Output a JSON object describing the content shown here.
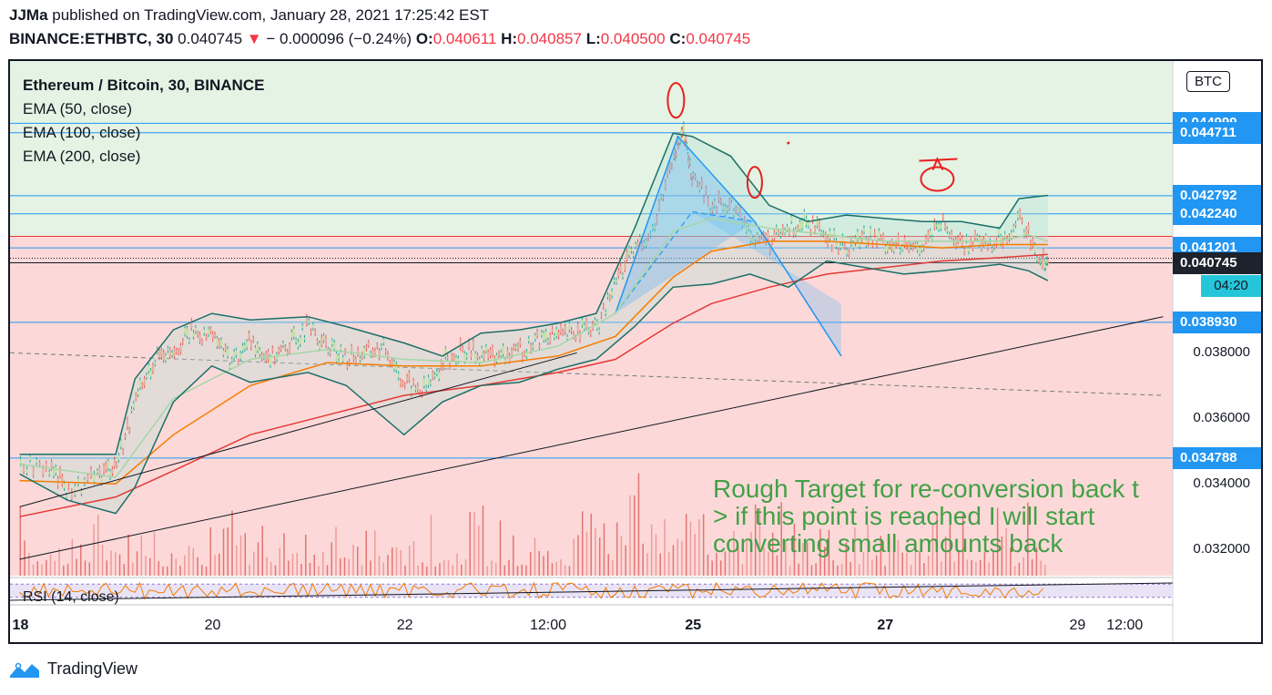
{
  "header": {
    "author": "JJMa",
    "published_text": " published on TradingView.com, January 28, 2021 17:25:42 EST",
    "symbol": "BINANCE:ETHBTC, 30",
    "last": "0.040745",
    "change": "− 0.000096 (−0.24%)",
    "o_label": "O:",
    "o_value": "0.040611",
    "h_label": "H:",
    "h_value": "0.040857",
    "l_label": "L:",
    "l_value": "0.040500",
    "c_label": "C:",
    "c_value": "0.040745"
  },
  "legend": {
    "title": "Ethereum / Bitcoin, 30, BINANCE",
    "ema50": "EMA (50, close)",
    "ema100": "EMA (100, close)",
    "ema200": "EMA (200, close)"
  },
  "currency_badge": "BTC",
  "rsi_label": "RSI (14, close)",
  "annotation": [
    "Rough Target for re-conversion back t",
    "> if this point is reached I will start",
    "converting small amounts back"
  ],
  "footer": {
    "brand": "TradingView"
  },
  "colors": {
    "green_zone": "#e4f3e3",
    "red_zone": "#fcd9d8",
    "ema50": "#a5d6a7",
    "ema100": "#f57c00",
    "ema200": "#e53935",
    "bb": "#1b6f67",
    "hline": "#2196f3",
    "annotation": "#43a047",
    "marker": "#e91e1e"
  },
  "chart_data": {
    "type": "candlestick",
    "x_ticks": [
      {
        "label": "18",
        "t": 0,
        "bold": true
      },
      {
        "label": "20",
        "t": 2
      },
      {
        "label": "22",
        "t": 4
      },
      {
        "label": "12:00",
        "t": 5.5
      },
      {
        "label": "25",
        "t": 7,
        "bold": true
      },
      {
        "label": "27",
        "t": 9,
        "bold": true
      },
      {
        "label": "29",
        "t": 11
      },
      {
        "label": "12:00",
        "t": 11.5
      }
    ],
    "xlim": [
      -0.1,
      12.0
    ],
    "ylim": [
      0.0312,
      0.0469
    ],
    "y_ticks": [
      {
        "label": "0.038000",
        "v": 0.038
      },
      {
        "label": "0.036000",
        "v": 0.036
      },
      {
        "label": "0.034000",
        "v": 0.034
      },
      {
        "label": "0.032000",
        "v": 0.032
      }
    ],
    "price_labels": [
      {
        "label": "0.044999",
        "v": 0.044999
      },
      {
        "label": "0.044711",
        "v": 0.044711
      },
      {
        "label": "0.042792",
        "v": 0.042792
      },
      {
        "label": "0.042240",
        "v": 0.04224
      },
      {
        "label": "0.041201",
        "v": 0.041201
      },
      {
        "label": "0.040745",
        "v": 0.040745,
        "style": "dark"
      },
      {
        "label": "0.038930",
        "v": 0.03893
      },
      {
        "label": "0.034788",
        "v": 0.034788
      }
    ],
    "countdown": "04:20",
    "resistance_line": 0.04155,
    "close_price": 0.040745,
    "close_series": [
      [
        0.0,
        0.0346
      ],
      [
        0.3,
        0.0344
      ],
      [
        0.5,
        0.0337
      ],
      [
        0.8,
        0.0341
      ],
      [
        1.0,
        0.0346
      ],
      [
        1.2,
        0.0364
      ],
      [
        1.4,
        0.0378
      ],
      [
        1.6,
        0.0381
      ],
      [
        1.8,
        0.0386
      ],
      [
        2.0,
        0.0384
      ],
      [
        2.2,
        0.0377
      ],
      [
        2.4,
        0.0383
      ],
      [
        2.6,
        0.0378
      ],
      [
        2.8,
        0.0382
      ],
      [
        3.0,
        0.0387
      ],
      [
        3.2,
        0.0381
      ],
      [
        3.4,
        0.0378
      ],
      [
        3.6,
        0.038
      ],
      [
        3.8,
        0.0381
      ],
      [
        4.0,
        0.037
      ],
      [
        4.2,
        0.0368
      ],
      [
        4.4,
        0.0376
      ],
      [
        4.6,
        0.038
      ],
      [
        4.8,
        0.0379
      ],
      [
        5.0,
        0.0378
      ],
      [
        5.2,
        0.038
      ],
      [
        5.4,
        0.0384
      ],
      [
        5.6,
        0.0384
      ],
      [
        5.8,
        0.0386
      ],
      [
        6.0,
        0.0387
      ],
      [
        6.2,
        0.0402
      ],
      [
        6.4,
        0.0411
      ],
      [
        6.6,
        0.0418
      ],
      [
        6.8,
        0.0441
      ],
      [
        6.9,
        0.0446
      ],
      [
        7.0,
        0.0432
      ],
      [
        7.2,
        0.0424
      ],
      [
        7.4,
        0.0425
      ],
      [
        7.6,
        0.0416
      ],
      [
        7.8,
        0.0413
      ],
      [
        8.0,
        0.0418
      ],
      [
        8.2,
        0.0419
      ],
      [
        8.4,
        0.0413
      ],
      [
        8.6,
        0.0412
      ],
      [
        8.8,
        0.0415
      ],
      [
        9.0,
        0.0413
      ],
      [
        9.2,
        0.0411
      ],
      [
        9.4,
        0.0413
      ],
      [
        9.6,
        0.0419
      ],
      [
        9.8,
        0.0412
      ],
      [
        10.0,
        0.0413
      ],
      [
        10.2,
        0.0414
      ],
      [
        10.4,
        0.042
      ],
      [
        10.6,
        0.0409
      ],
      [
        10.7,
        0.04074
      ]
    ],
    "ema50": [
      [
        0.0,
        0.0346
      ],
      [
        1.0,
        0.0342
      ],
      [
        1.6,
        0.0366
      ],
      [
        2.4,
        0.0378
      ],
      [
        3.2,
        0.0381
      ],
      [
        4.0,
        0.0378
      ],
      [
        4.8,
        0.0377
      ],
      [
        5.6,
        0.0382
      ],
      [
        6.2,
        0.0392
      ],
      [
        6.8,
        0.0417
      ],
      [
        7.2,
        0.0421
      ],
      [
        7.8,
        0.0418
      ],
      [
        8.4,
        0.0416
      ],
      [
        9.0,
        0.0414
      ],
      [
        9.6,
        0.0414
      ],
      [
        10.2,
        0.0414
      ],
      [
        10.5,
        0.0416
      ],
      [
        10.7,
        0.0414
      ]
    ],
    "ema100": [
      [
        0.0,
        0.0341
      ],
      [
        1.0,
        0.034
      ],
      [
        1.6,
        0.0355
      ],
      [
        2.4,
        0.037
      ],
      [
        3.2,
        0.0377
      ],
      [
        4.0,
        0.0376
      ],
      [
        4.8,
        0.0376
      ],
      [
        5.6,
        0.0379
      ],
      [
        6.2,
        0.0385
      ],
      [
        6.8,
        0.0403
      ],
      [
        7.2,
        0.0411
      ],
      [
        7.8,
        0.0414
      ],
      [
        8.4,
        0.0414
      ],
      [
        9.0,
        0.0413
      ],
      [
        9.6,
        0.0412
      ],
      [
        10.2,
        0.0413
      ],
      [
        10.7,
        0.0413
      ]
    ],
    "ema200": [
      [
        0.0,
        0.033
      ],
      [
        1.0,
        0.0336
      ],
      [
        1.6,
        0.0344
      ],
      [
        2.4,
        0.0355
      ],
      [
        3.2,
        0.0361
      ],
      [
        4.0,
        0.0367
      ],
      [
        4.8,
        0.037
      ],
      [
        5.6,
        0.0374
      ],
      [
        6.2,
        0.0378
      ],
      [
        6.8,
        0.0389
      ],
      [
        7.2,
        0.0395
      ],
      [
        7.8,
        0.04
      ],
      [
        8.4,
        0.0404
      ],
      [
        9.0,
        0.0406
      ],
      [
        9.6,
        0.0408
      ],
      [
        10.2,
        0.0409
      ],
      [
        10.7,
        0.041
      ]
    ],
    "bb_upper": [
      [
        0.0,
        0.0349
      ],
      [
        1.0,
        0.0349
      ],
      [
        1.2,
        0.0372
      ],
      [
        1.6,
        0.0387
      ],
      [
        2.0,
        0.0392
      ],
      [
        2.4,
        0.039
      ],
      [
        3.0,
        0.0391
      ],
      [
        3.4,
        0.0388
      ],
      [
        4.0,
        0.0383
      ],
      [
        4.4,
        0.0379
      ],
      [
        4.8,
        0.0386
      ],
      [
        5.2,
        0.0387
      ],
      [
        5.6,
        0.0389
      ],
      [
        6.0,
        0.0392
      ],
      [
        6.4,
        0.0418
      ],
      [
        6.8,
        0.0447
      ],
      [
        7.0,
        0.0446
      ],
      [
        7.4,
        0.044
      ],
      [
        7.8,
        0.0425
      ],
      [
        8.2,
        0.042
      ],
      [
        8.6,
        0.0422
      ],
      [
        9.0,
        0.0421
      ],
      [
        9.4,
        0.042
      ],
      [
        9.8,
        0.042
      ],
      [
        10.2,
        0.0418
      ],
      [
        10.4,
        0.0427
      ],
      [
        10.7,
        0.0428
      ]
    ],
    "bb_lower": [
      [
        0.0,
        0.0343
      ],
      [
        0.5,
        0.0335
      ],
      [
        1.0,
        0.0331
      ],
      [
        1.2,
        0.0339
      ],
      [
        1.6,
        0.0365
      ],
      [
        2.0,
        0.0376
      ],
      [
        2.4,
        0.0371
      ],
      [
        3.0,
        0.0374
      ],
      [
        3.4,
        0.037
      ],
      [
        4.0,
        0.0355
      ],
      [
        4.4,
        0.0365
      ],
      [
        4.8,
        0.037
      ],
      [
        5.2,
        0.0371
      ],
      [
        5.6,
        0.0375
      ],
      [
        6.0,
        0.0378
      ],
      [
        6.4,
        0.0388
      ],
      [
        6.8,
        0.04
      ],
      [
        7.2,
        0.0401
      ],
      [
        7.6,
        0.0404
      ],
      [
        8.0,
        0.04
      ],
      [
        8.4,
        0.0408
      ],
      [
        8.8,
        0.0406
      ],
      [
        9.2,
        0.0404
      ],
      [
        9.6,
        0.0405
      ],
      [
        10.2,
        0.0407
      ],
      [
        10.5,
        0.0405
      ],
      [
        10.7,
        0.0402
      ]
    ],
    "trendline_lower": [
      [
        0.0,
        0.0317
      ],
      [
        11.9,
        0.0391
      ]
    ],
    "trendline_channel": [
      [
        0.0,
        0.0333
      ],
      [
        5.8,
        0.038
      ]
    ],
    "dashed_line": [
      [
        -0.1,
        0.038
      ],
      [
        11.9,
        0.0367
      ]
    ],
    "harmonic_pattern": {
      "leg1": [
        [
          6.2,
          0.0392
        ],
        [
          6.85,
          0.0446
        ],
        [
          7.65,
          0.042
        ],
        [
          8.55,
          0.0379
        ]
      ],
      "leg2": [
        [
          6.2,
          0.0392
        ],
        [
          7.0,
          0.0423
        ],
        [
          7.65,
          0.042
        ],
        [
          8.55,
          0.0379
        ]
      ],
      "fill_a": [
        [
          6.2,
          0.0392
        ],
        [
          6.85,
          0.0446
        ],
        [
          7.65,
          0.042
        ]
      ],
      "fill_b": [
        [
          7.0,
          0.0423
        ],
        [
          7.65,
          0.042
        ],
        [
          8.55,
          0.0379
        ],
        [
          8.55,
          0.0395
        ]
      ]
    },
    "volume_profile_max": 0.001,
    "rsi_band": [
      0.25,
      0.75
    ]
  }
}
